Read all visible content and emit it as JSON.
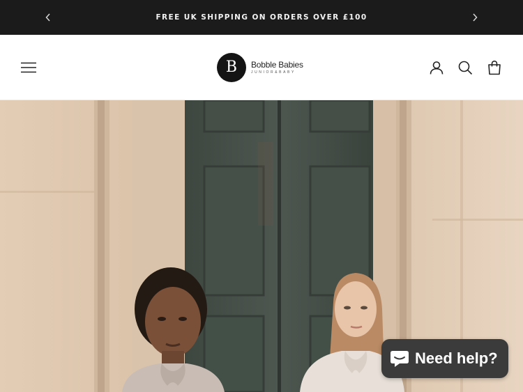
{
  "announcement": {
    "text": "FREE UK SHIPPING ON ORDERS OVER £100",
    "prev_icon": "chevron-left-icon",
    "next_icon": "chevron-right-icon"
  },
  "header": {
    "menu_icon": "hamburger-menu-icon",
    "logo": {
      "mark": "B",
      "name": "Bobble Babies",
      "tagline": "JUNIOR&BABY"
    },
    "icons": [
      "account-icon",
      "search-icon",
      "bag-icon"
    ]
  },
  "hero": {
    "image": "two-girls-in-front-of-green-door"
  },
  "chat": {
    "label": "Need help?",
    "icon": "chat-bubble-icon",
    "background": "#3b3b3b"
  },
  "colors": {
    "announcement_bg": "#1b1b1b",
    "header_bg": "#ffffff",
    "text_dark": "#222222"
  }
}
